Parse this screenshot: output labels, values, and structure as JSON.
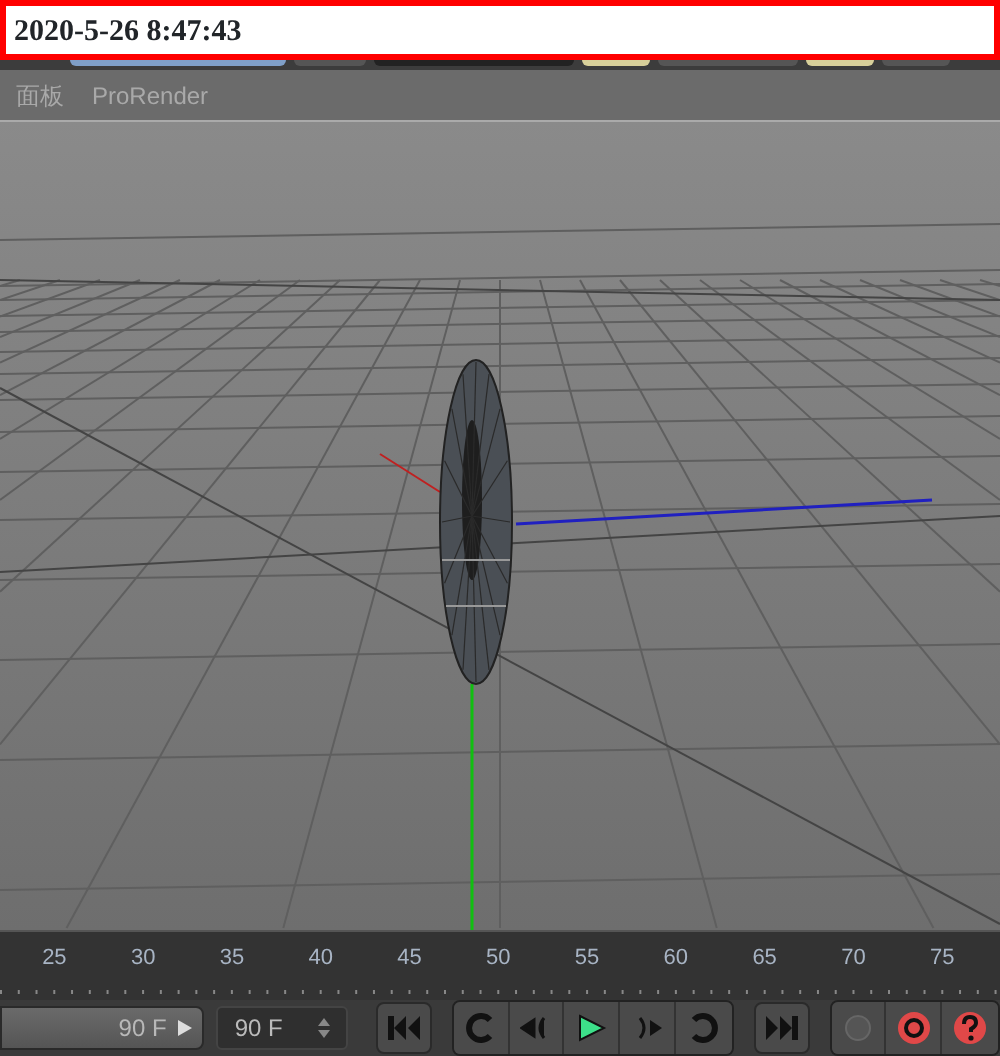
{
  "caption": "2020-5-26 8:47:43",
  "menu": [
    "面板",
    "ProRender"
  ],
  "timeline": {
    "ticks": [
      "25",
      "30",
      "35",
      "40",
      "45",
      "50",
      "55",
      "60",
      "65",
      "70",
      "75"
    ]
  },
  "end_frame": {
    "value": "90 F"
  },
  "max_frame": {
    "value": "90 F"
  }
}
